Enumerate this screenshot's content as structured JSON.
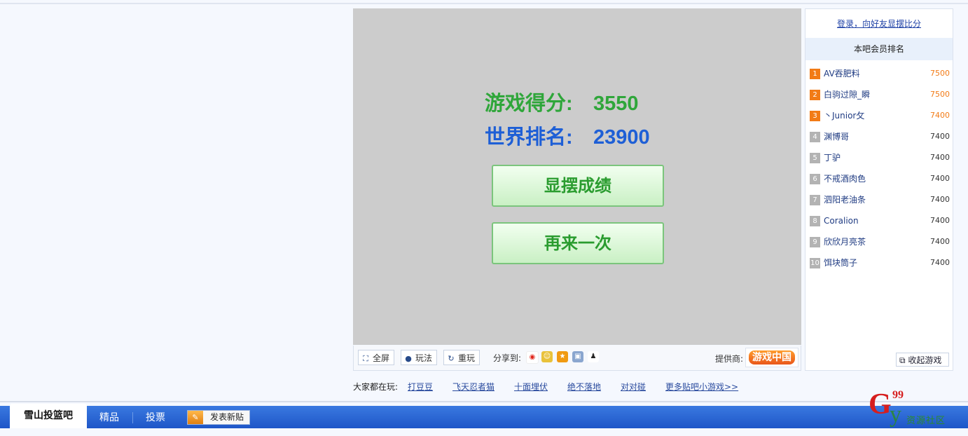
{
  "game": {
    "score_label": "游戏得分:",
    "score_value": "3550",
    "rank_label": "世界排名:",
    "rank_value": "23900",
    "show_button": "显摆成绩",
    "replay_button": "再来一次"
  },
  "toolbar": {
    "fullscreen": "全屏",
    "howto": "玩法",
    "restart": "重玩",
    "share_label": "分享到:",
    "provider_label": "提供商:",
    "provider_logo": "游戏中国",
    "share_icons": [
      "weibo-icon",
      "renren-icon",
      "qzone-icon",
      "kaixin-icon",
      "qq-icon"
    ]
  },
  "ranking": {
    "login_link": "登录，向好友显摆比分",
    "header": "本吧会员排名",
    "items": [
      {
        "num": "1",
        "name": "AV吞肥料",
        "score": "7500"
      },
      {
        "num": "2",
        "name": "白驹过隙_瞬",
        "score": "7500"
      },
      {
        "num": "3",
        "name": "丶Junior攵",
        "score": "7400"
      },
      {
        "num": "4",
        "name": "渊博哥",
        "score": "7400"
      },
      {
        "num": "5",
        "name": "丁驴",
        "score": "7400"
      },
      {
        "num": "6",
        "name": "不戒酒肉色",
        "score": "7400"
      },
      {
        "num": "7",
        "name": "泗阳老油条",
        "score": "7400"
      },
      {
        "num": "8",
        "name": "Coralion",
        "score": "7400"
      },
      {
        "num": "9",
        "name": "欣欣月亮茶",
        "score": "7400"
      },
      {
        "num": "10",
        "name": "饵块筒子",
        "score": "7400"
      }
    ],
    "collapse_button": "收起游戏"
  },
  "playing": {
    "label": "大家都在玩:",
    "links": [
      "打豆豆",
      "飞天忍者猫",
      "十面埋伏",
      "绝不落地",
      "对对碰",
      "更多贴吧小游戏>>"
    ]
  },
  "bottom_nav": {
    "active_tab": "雪山投篮吧",
    "tab_featured": "精品",
    "tab_vote": "投票",
    "post_button": "发表新贴"
  },
  "watermark": {
    "g": "G",
    "num": "99",
    "y": "y",
    "text": "资源社区"
  },
  "colors": {
    "score_green": "#2fa63a",
    "rank_blue": "#1e5fd6",
    "top_rank_orange": "#f27b16",
    "nav_blue": "#1e56c8"
  }
}
